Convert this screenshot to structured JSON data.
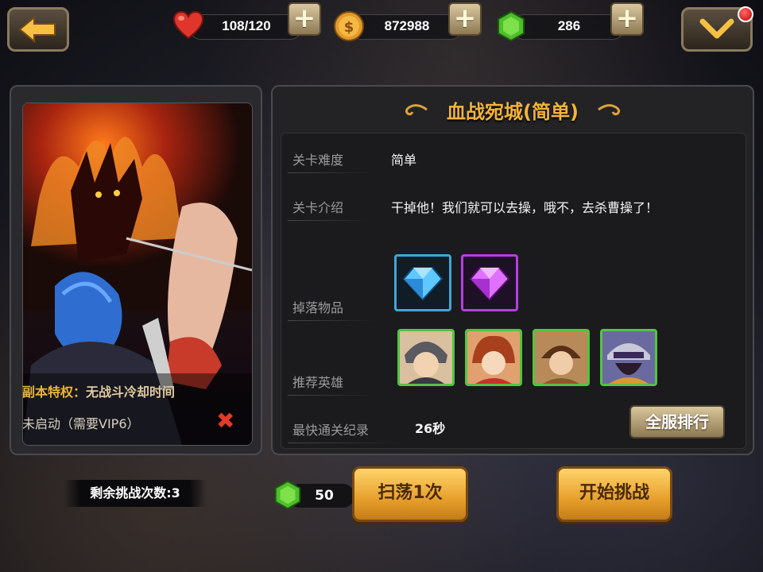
{
  "topbar": {
    "stamina": "108/120",
    "gold": "872988",
    "gems": "286",
    "plus_symbol": "+"
  },
  "colors": {
    "accent_gold": "#f2b43a",
    "hero_border": "#52c442",
    "blue_gem_border": "#3fa8d8",
    "purple_gem_border": "#b63ee0",
    "button_orange": "#e7a02c"
  },
  "left_panel": {
    "privilege_label": "副本特权：",
    "privilege_text": "无战斗冷却时间",
    "vip_status": "未启动（需要VIP6）",
    "x_symbol": "✖"
  },
  "stage": {
    "title": "血战宛城(简单)",
    "difficulty_label": "关卡难度",
    "difficulty_value": "简单",
    "intro_label": "关卡介绍",
    "intro_value": "干掉他！我们就可以去操，哦不，去杀曹操了！",
    "drops_label": "掉落物品",
    "drops": [
      "blue-gem-icon",
      "purple-gem-icon"
    ],
    "heroes_label": "推荐英雄",
    "heroes": [
      "hero-1",
      "hero-2",
      "hero-3",
      "hero-4"
    ],
    "record_label": "最快通关纪录",
    "record_value": "26秒",
    "rank_button": "全服排行"
  },
  "bottom": {
    "remaining": "剩余挑战次数:3",
    "sweep_cost": "50",
    "sweep_button": "扫荡1次",
    "start_button": "开始挑战"
  }
}
